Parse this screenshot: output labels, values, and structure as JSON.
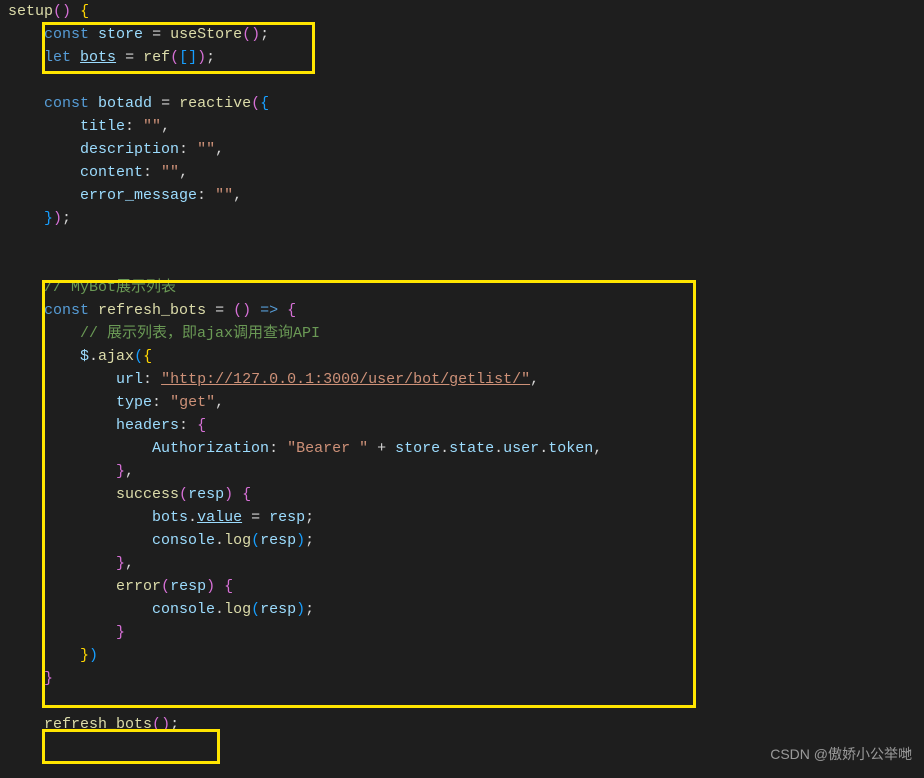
{
  "lines": [
    {
      "i": 0,
      "html": [
        [
          "fn",
          "setup"
        ],
        [
          "brace-p",
          "("
        ],
        [
          "brace-p",
          ")"
        ],
        [
          "op",
          " "
        ],
        [
          "brace",
          "{"
        ]
      ]
    },
    {
      "i": 1,
      "html": [
        [
          "kw",
          "const"
        ],
        [
          "op",
          " "
        ],
        [
          "var",
          "store"
        ],
        [
          "op",
          " = "
        ],
        [
          "fn",
          "useStore"
        ],
        [
          "brace-p",
          "("
        ],
        [
          "brace-p",
          ")"
        ],
        [
          "op",
          ";"
        ]
      ]
    },
    {
      "i": 1,
      "html": [
        [
          "kw",
          "let"
        ],
        [
          "op",
          " "
        ],
        [
          "var-und",
          "bots"
        ],
        [
          "op",
          " = "
        ],
        [
          "fn",
          "ref"
        ],
        [
          "brace-p",
          "("
        ],
        [
          "brace-b",
          "["
        ],
        [
          "brace-b",
          "]"
        ],
        [
          "brace-p",
          ")"
        ],
        [
          "op",
          ";"
        ]
      ]
    },
    {
      "i": 0,
      "html": ""
    },
    {
      "i": 1,
      "html": [
        [
          "kw",
          "const"
        ],
        [
          "op",
          " "
        ],
        [
          "var",
          "botadd"
        ],
        [
          "op",
          " = "
        ],
        [
          "fn",
          "reactive"
        ],
        [
          "brace-p",
          "("
        ],
        [
          "brace-b",
          "{"
        ]
      ]
    },
    {
      "i": 2,
      "html": [
        [
          "var",
          "title"
        ],
        [
          "op",
          ": "
        ],
        [
          "str",
          "\"\""
        ],
        [
          "op",
          ","
        ]
      ]
    },
    {
      "i": 2,
      "html": [
        [
          "var",
          "description"
        ],
        [
          "op",
          ": "
        ],
        [
          "str",
          "\"\""
        ],
        [
          "op",
          ","
        ]
      ]
    },
    {
      "i": 2,
      "html": [
        [
          "var",
          "content"
        ],
        [
          "op",
          ": "
        ],
        [
          "str",
          "\"\""
        ],
        [
          "op",
          ","
        ]
      ]
    },
    {
      "i": 2,
      "html": [
        [
          "var",
          "error_message"
        ],
        [
          "op",
          ": "
        ],
        [
          "str",
          "\"\""
        ],
        [
          "op",
          ","
        ]
      ]
    },
    {
      "i": 1,
      "html": [
        [
          "brace-b",
          "}"
        ],
        [
          "brace-p",
          ")"
        ],
        [
          "op",
          ";"
        ]
      ]
    },
    {
      "i": 0,
      "html": ""
    },
    {
      "i": 0,
      "html": ""
    },
    {
      "i": 1,
      "html": [
        [
          "cmt",
          "// MyBot展示列表"
        ]
      ]
    },
    {
      "i": 1,
      "html": [
        [
          "kw",
          "const"
        ],
        [
          "op",
          " "
        ],
        [
          "fn",
          "refresh_bots"
        ],
        [
          "op",
          " = "
        ],
        [
          "brace-p",
          "("
        ],
        [
          "brace-p",
          ")"
        ],
        [
          "op",
          " "
        ],
        [
          "kw",
          "=>"
        ],
        [
          "op",
          " "
        ],
        [
          "brace-p",
          "{"
        ]
      ]
    },
    {
      "i": 2,
      "html": [
        [
          "cmt",
          "// 展示列表，即ajax调用查询API"
        ]
      ]
    },
    {
      "i": 2,
      "html": [
        [
          "var",
          "$"
        ],
        [
          "op",
          "."
        ],
        [
          "fn",
          "ajax"
        ],
        [
          "brace-b",
          "("
        ],
        [
          "brace",
          "{"
        ]
      ]
    },
    {
      "i": 3,
      "html": [
        [
          "var",
          "url"
        ],
        [
          "op",
          ": "
        ],
        [
          "str-und",
          "\"http://127.0.0.1:3000/user/bot/getlist/\""
        ],
        [
          "op",
          ","
        ]
      ]
    },
    {
      "i": 3,
      "html": [
        [
          "var",
          "type"
        ],
        [
          "op",
          ": "
        ],
        [
          "str",
          "\"get\""
        ],
        [
          "op",
          ","
        ]
      ]
    },
    {
      "i": 3,
      "html": [
        [
          "var",
          "headers"
        ],
        [
          "op",
          ": "
        ],
        [
          "brace-p",
          "{"
        ]
      ]
    },
    {
      "i": 4,
      "html": [
        [
          "var",
          "Authorization"
        ],
        [
          "op",
          ": "
        ],
        [
          "str",
          "\"Bearer \""
        ],
        [
          "op",
          " + "
        ],
        [
          "var",
          "store"
        ],
        [
          "op",
          "."
        ],
        [
          "var",
          "state"
        ],
        [
          "op",
          "."
        ],
        [
          "var",
          "user"
        ],
        [
          "op",
          "."
        ],
        [
          "var",
          "token"
        ],
        [
          "op",
          ","
        ]
      ]
    },
    {
      "i": 3,
      "html": [
        [
          "brace-p",
          "}"
        ],
        [
          "op",
          ","
        ]
      ]
    },
    {
      "i": 3,
      "html": [
        [
          "fn",
          "success"
        ],
        [
          "brace-p",
          "("
        ],
        [
          "var",
          "resp"
        ],
        [
          "brace-p",
          ")"
        ],
        [
          "op",
          " "
        ],
        [
          "brace-p",
          "{"
        ]
      ]
    },
    {
      "i": 4,
      "html": [
        [
          "var",
          "bots"
        ],
        [
          "op",
          "."
        ],
        [
          "var-und",
          "value"
        ],
        [
          "op",
          " = "
        ],
        [
          "var",
          "resp"
        ],
        [
          "op",
          ";"
        ]
      ]
    },
    {
      "i": 4,
      "html": [
        [
          "var",
          "console"
        ],
        [
          "op",
          "."
        ],
        [
          "fn",
          "log"
        ],
        [
          "brace-b",
          "("
        ],
        [
          "var",
          "resp"
        ],
        [
          "brace-b",
          ")"
        ],
        [
          "op",
          ";"
        ]
      ]
    },
    {
      "i": 3,
      "html": [
        [
          "brace-p",
          "}"
        ],
        [
          "op",
          ","
        ]
      ]
    },
    {
      "i": 3,
      "html": [
        [
          "fn",
          "error"
        ],
        [
          "brace-p",
          "("
        ],
        [
          "var",
          "resp"
        ],
        [
          "brace-p",
          ")"
        ],
        [
          "op",
          " "
        ],
        [
          "brace-p",
          "{"
        ]
      ]
    },
    {
      "i": 4,
      "html": [
        [
          "var",
          "console"
        ],
        [
          "op",
          "."
        ],
        [
          "fn",
          "log"
        ],
        [
          "brace-b",
          "("
        ],
        [
          "var",
          "resp"
        ],
        [
          "brace-b",
          ")"
        ],
        [
          "op",
          ";"
        ]
      ]
    },
    {
      "i": 3,
      "html": [
        [
          "brace-p",
          "}"
        ]
      ]
    },
    {
      "i": 2,
      "html": [
        [
          "brace",
          "}"
        ],
        [
          "brace-b",
          ")"
        ]
      ]
    },
    {
      "i": 1,
      "html": [
        [
          "brace-p",
          "}"
        ]
      ]
    },
    {
      "i": 0,
      "html": ""
    },
    {
      "i": 1,
      "html": [
        [
          "fn",
          "refresh_bots"
        ],
        [
          "brace-p",
          "("
        ],
        [
          "brace-p",
          ")"
        ],
        [
          "op",
          ";"
        ]
      ]
    }
  ],
  "watermark": "CSDN @傲娇小公举哋",
  "indentUnit": 4
}
